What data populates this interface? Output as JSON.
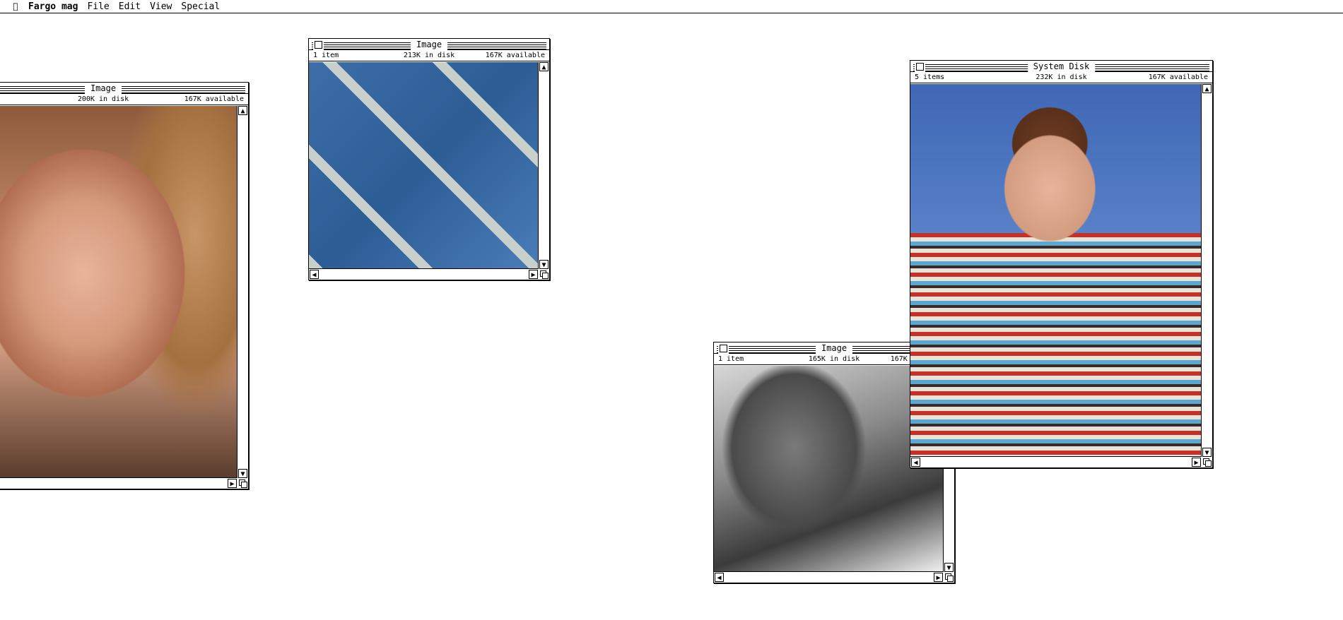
{
  "menubar": {
    "apple_icon": "apple-icon",
    "app_name": "Fargo mag",
    "menus": [
      "File",
      "Edit",
      "View",
      "Special"
    ]
  },
  "windows": [
    {
      "id": "image-portrait",
      "title": "Image",
      "items": "",
      "disk": "200K in disk",
      "available": "167K available",
      "photo": "portrait of young woman with hand on chin"
    },
    {
      "id": "image-floppy",
      "title": "Image",
      "items": "1 item",
      "disk": "213K in disk",
      "available": "167K available",
      "photo": "blue floppy disks pattern"
    },
    {
      "id": "image-bw",
      "title": "Image",
      "items": "1 item",
      "disk": "165K in disk",
      "available": "167K available",
      "photo": "black and white back of head"
    },
    {
      "id": "system-disk",
      "title": "System Disk",
      "items": "5 items",
      "disk": "232K in disk",
      "available": "167K available",
      "photo": "man in striped sweater on blue background"
    }
  ],
  "icons": {
    "scroll_up": "▲",
    "scroll_down": "▼",
    "scroll_left": "◀",
    "scroll_right": "▶"
  }
}
